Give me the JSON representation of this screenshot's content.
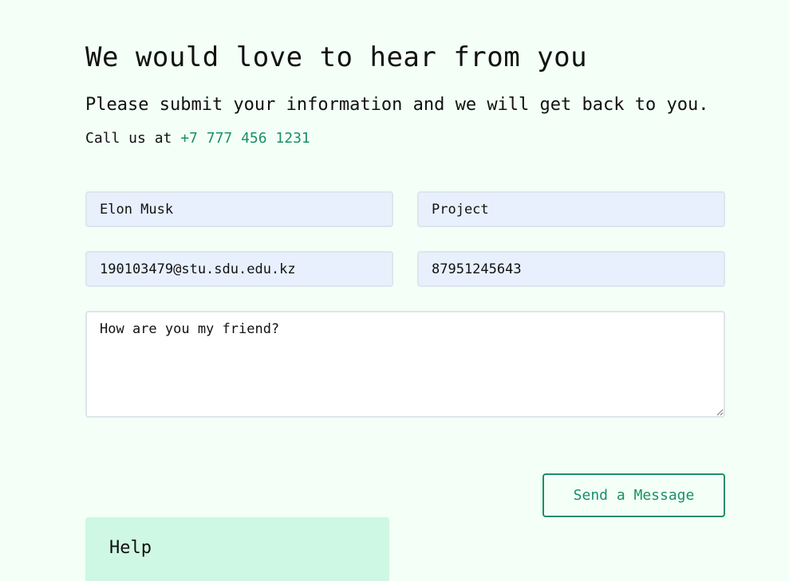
{
  "contact": {
    "heading": "We would love to hear from you",
    "subheading": "Please submit your information and we will get back to you.",
    "call_prefix": "Call us at ",
    "phone": "+7 777 456 1231",
    "accent_color": "#1a8f6a"
  },
  "form": {
    "name_value": "Elon Musk",
    "subject_value": "Project",
    "email_value": "190103479@stu.sdu.edu.kz",
    "phone_value": "87951245643",
    "message_value": "How are you my friend?",
    "submit_label": "Send a Message"
  },
  "help": {
    "title": "Help"
  }
}
